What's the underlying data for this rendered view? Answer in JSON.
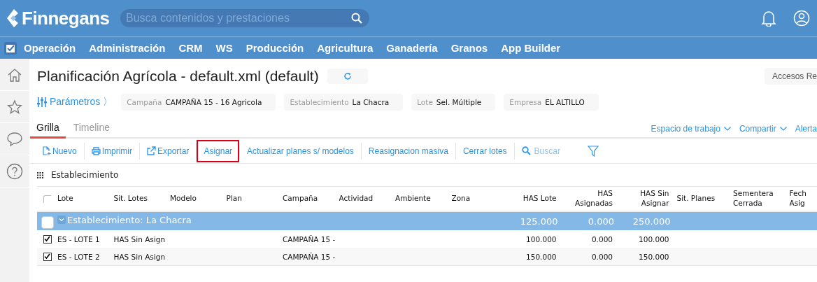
{
  "header": {
    "logo": "Finnegans",
    "search": {
      "placeholder": "Busca contenidos y prestaciones"
    }
  },
  "menu": [
    "Operación",
    "Administración",
    "CRM",
    "WS",
    "Producción",
    "Agricultura",
    "Ganadería",
    "Granos",
    "App Builder"
  ],
  "sidebar": {
    "items": [
      {
        "kind": "home"
      },
      {
        "kind": "star"
      },
      {
        "kind": "chat"
      },
      {
        "kind": "help"
      }
    ]
  },
  "page": {
    "title": "Planificación Agrícola - default.xml (default)",
    "shortcuts": "Accesos Re"
  },
  "parameters": {
    "label": "Parámetros 〉",
    "filters": [
      {
        "label": "Campaña",
        "value": "CAMPAÑA 15 - 16 Agricola"
      },
      {
        "label": "Establecimiento",
        "value": "La Chacra"
      },
      {
        "label": "Lote",
        "value": "Sel. Múltiple"
      },
      {
        "label": "Empresa",
        "value": "EL ALTILLO"
      }
    ]
  },
  "tabs": [
    {
      "label": "Grilla",
      "selected": true
    },
    {
      "label": "Timeline",
      "selected": false
    }
  ],
  "actions": [
    {
      "label": "Espacio de trabajo",
      "caret": true
    },
    {
      "label": "Compartir",
      "caret": true
    },
    {
      "label": "Alerta",
      "caret": false
    }
  ],
  "toolbar": [
    {
      "label": "Nuevo",
      "kind": "new",
      "highlighted": false
    },
    {
      "label": "Imprimir",
      "kind": "print",
      "highlighted": false
    },
    {
      "label": "Exportar",
      "kind": "export",
      "highlighted": false
    },
    {
      "label": "Asignar",
      "kind": "plain",
      "highlighted": true
    },
    {
      "label": "Actualizar planes s/ modelos",
      "kind": "plain",
      "highlighted": false
    },
    {
      "label": "Reasignacion masiva",
      "kind": "plain",
      "highlighted": false
    },
    {
      "label": "Cerrar lotes",
      "kind": "plain",
      "highlighted": false
    }
  ],
  "search": {
    "placeholder": "Buscar"
  },
  "grouping": "Establecimiento",
  "table": {
    "all_checked": false,
    "columns": [
      "Lote",
      "Sit. Lotes",
      "Modelo",
      "Plan",
      "Campaña",
      "Actividad",
      "Ambiente",
      "Zona",
      "HAS Lote",
      "HAS\nAsignadas",
      "HAS Sin\nAsignar",
      "Sit. Planes",
      "Sementera\nCerrada",
      "Fech\nAsig"
    ],
    "group": {
      "label": "Establecimiento: La Chacra",
      "checked": false,
      "expanded": true,
      "has_lote": "125.000",
      "has_asignadas": "0.000",
      "has_sin_asignar": "250.000"
    },
    "rows": [
      {
        "checked": true,
        "lote": "ES - LOTE 1",
        "sit_lotes": "HAS Sin Asign",
        "campana": "CAMPAÑA 15 -",
        "has_lote": "100.000",
        "has_asignadas": "0.000",
        "has_sin_asignar": "100.000"
      },
      {
        "checked": true,
        "lote": "ES - LOTE 2",
        "sit_lotes": "HAS Sin Asign",
        "campana": "CAMPAÑA 15 -",
        "has_lote": "150.000",
        "has_asignadas": "0.000",
        "has_sin_asignar": "150.000"
      }
    ]
  }
}
